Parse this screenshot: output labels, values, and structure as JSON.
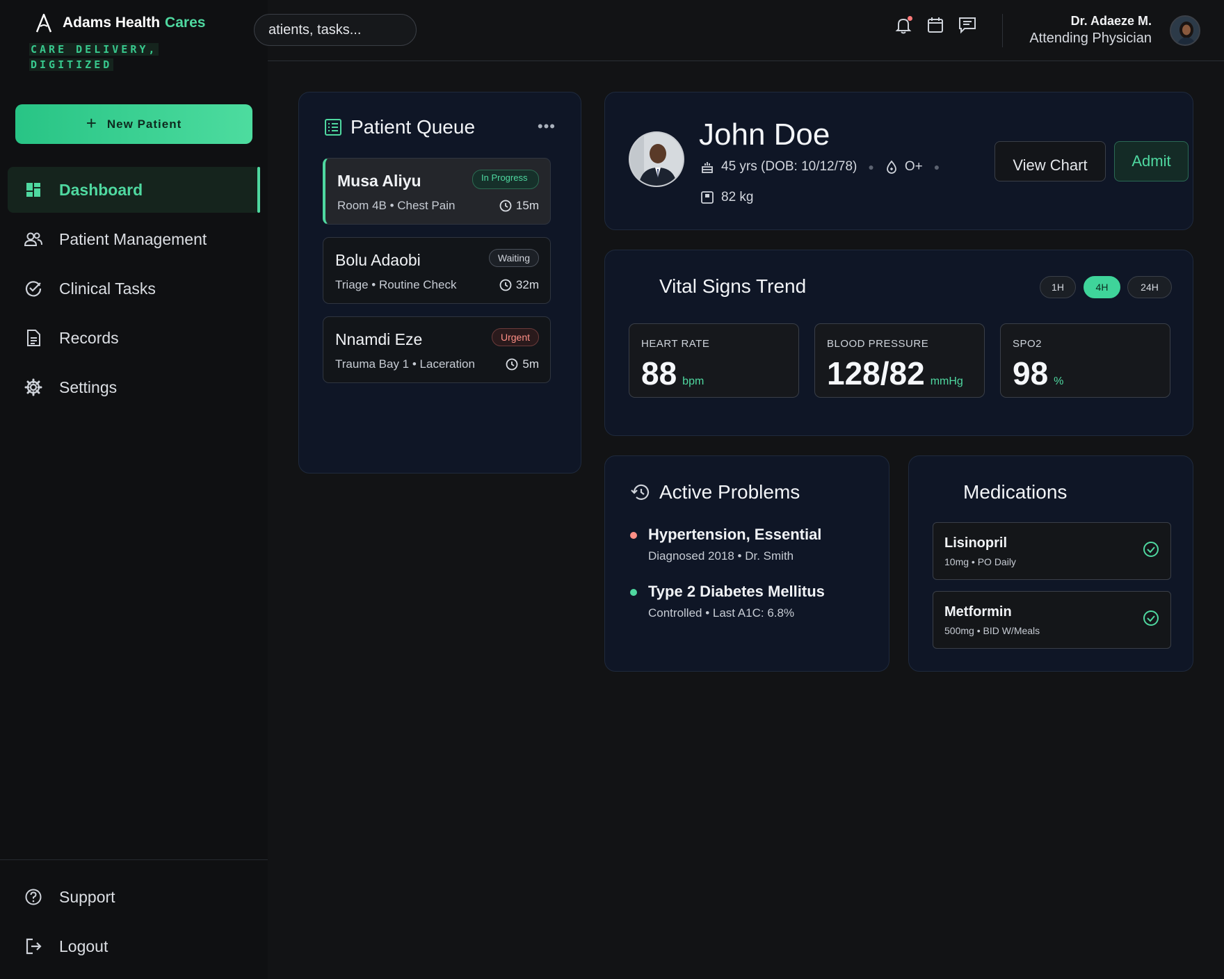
{
  "brand": {
    "name": "Adams Health",
    "name_accent": "Cares",
    "tagline_line1": "CARE DELIVERY,",
    "tagline_line2": "DIGITIZED"
  },
  "sidebar": {
    "new_patient_label": "New Patient",
    "items": [
      {
        "label": "Dashboard",
        "icon": "dashboard-icon",
        "active": true
      },
      {
        "label": "Patient Management",
        "icon": "users-icon"
      },
      {
        "label": "Clinical Tasks",
        "icon": "check-circle-icon"
      },
      {
        "label": "Records",
        "icon": "document-icon"
      },
      {
        "label": "Settings",
        "icon": "gear-icon"
      }
    ],
    "bottom_items": [
      {
        "label": "Support",
        "icon": "help-circle-icon"
      },
      {
        "label": "Logout",
        "icon": "logout-icon"
      }
    ]
  },
  "topbar": {
    "search_placeholder": "atients, tasks...",
    "user_name": "Dr. Adaeze M.",
    "user_role": "Attending Physician"
  },
  "queue": {
    "title": "Patient Queue",
    "items": [
      {
        "name": "Musa Aliyu",
        "sub": "Room 4B • Chest Pain",
        "status": "In Progress",
        "time": "15m"
      },
      {
        "name": "Bolu Adaobi",
        "sub": "Triage • Routine Check",
        "status": "Waiting",
        "time": "32m"
      },
      {
        "name": "Nnamdi Eze",
        "sub": "Trauma Bay 1 • Laceration",
        "status": "Urgent",
        "time": "5m"
      }
    ]
  },
  "patient": {
    "name": "John Doe",
    "age": "45 yrs (DOB: 10/12/78)",
    "blood": "O+",
    "weight": "82 kg",
    "view_chart_label": "View Chart",
    "admit_label": "Admit"
  },
  "vitals": {
    "title": "Vital Signs Trend",
    "ranges": [
      "1H",
      "4H",
      "24H"
    ],
    "active_range": "4H",
    "cards": [
      {
        "label": "HEART RATE",
        "value": "88",
        "unit": "bpm"
      },
      {
        "label": "BLOOD PRESSURE",
        "value": "128/82",
        "unit": "mmHg"
      },
      {
        "label": "SPO2",
        "value": "98",
        "unit": "%"
      }
    ]
  },
  "problems": {
    "title": "Active Problems",
    "items": [
      {
        "name": "Hypertension, Essential",
        "sub": "Diagnosed 2018 • Dr. Smith",
        "color": "#ff8f86"
      },
      {
        "name": "Type 2 Diabetes Mellitus",
        "sub": "Controlled • Last A1C: 6.8%",
        "color": "#4fd8a0"
      }
    ]
  },
  "medications": {
    "title": "Medications",
    "items": [
      {
        "name": "Lisinopril",
        "sub": "10mg • PO Daily"
      },
      {
        "name": "Metformin",
        "sub": "500mg • BID W/Meals"
      }
    ]
  },
  "colors": {
    "accent": "#4fd8a0",
    "urgent": "#ff8f86",
    "card_bg": "#0f1626"
  }
}
